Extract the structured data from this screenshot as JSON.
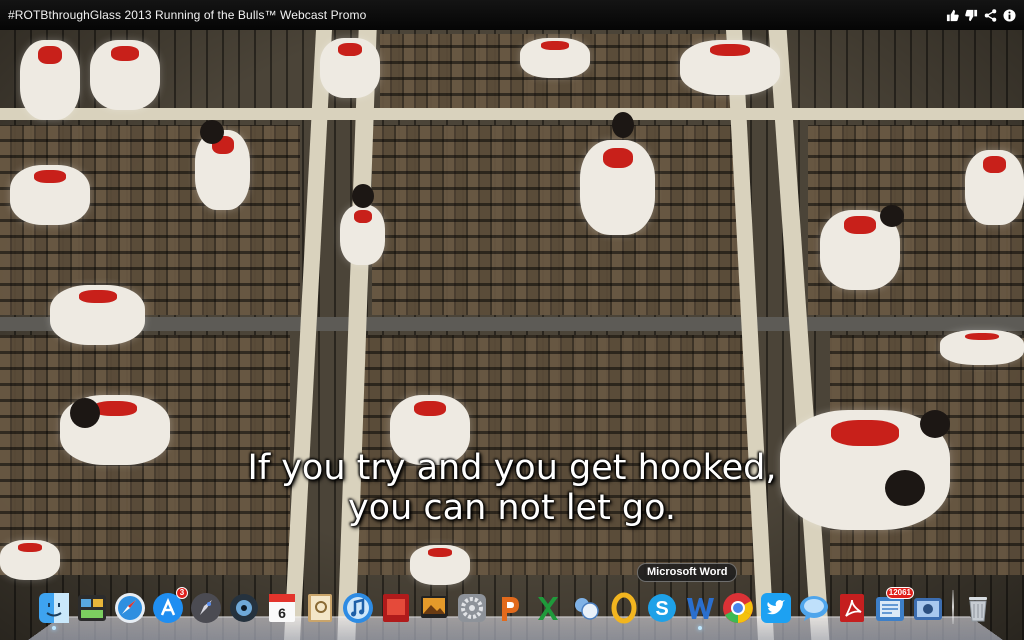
{
  "window": {
    "title": "#ROTBthroughGlass 2013 Running of the Bulls™ Webcast Promo",
    "actions": [
      {
        "name": "thumbs-up-icon"
      },
      {
        "name": "thumbs-down-icon"
      },
      {
        "name": "share-icon"
      },
      {
        "name": "info-icon"
      }
    ]
  },
  "subtitle": {
    "line1": "If you try and you get hooked,",
    "line2": "you can not let go."
  },
  "tooltip": {
    "label": "Microsoft Word"
  },
  "dock": {
    "app_store_badge": "3",
    "calendar_day": "6",
    "news_badge": "12061"
  },
  "colors": {
    "titlebar": "#0a0a0a",
    "runner_white": "#eeeae2",
    "sash_red": "#c8201a",
    "street_stripe": "#d9d2bd"
  }
}
